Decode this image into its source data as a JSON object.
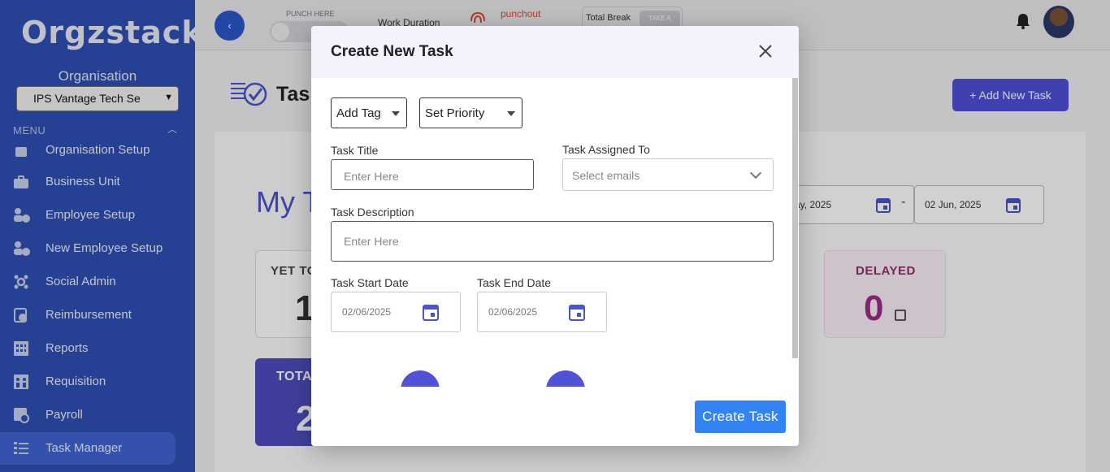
{
  "app": {
    "logo": "Orgzstack"
  },
  "sidebar": {
    "org_label": "Organisation",
    "org_value": "IPS Vantage Tech Se",
    "menu_label": "MENU",
    "items": [
      {
        "label": "Organisation Setup",
        "icon": "org-setup-icon"
      },
      {
        "label": "Business Unit",
        "icon": "briefcase-icon"
      },
      {
        "label": "Employee Setup",
        "icon": "users-gear-icon"
      },
      {
        "label": "New Employee Setup",
        "icon": "users-gear-icon"
      },
      {
        "label": "Social Admin",
        "icon": "social-icon"
      },
      {
        "label": "Reimbursement",
        "icon": "reimbursement-icon"
      },
      {
        "label": "Reports",
        "icon": "reports-icon"
      },
      {
        "label": "Requisition",
        "icon": "requisition-icon"
      },
      {
        "label": "Payroll",
        "icon": "payroll-icon"
      },
      {
        "label": "Task Manager",
        "icon": "task-list-icon",
        "active": true
      }
    ]
  },
  "topbar": {
    "punch_label": "PUNCH HERE",
    "work_duration": "Work Duration",
    "punchout": "punchout",
    "total_break": "Total Break",
    "take_break": "TAKE A"
  },
  "main": {
    "heading": "Task",
    "add_task": "+ Add New Task",
    "my_title": "My T",
    "date_from": "ay, 2025",
    "date_to": "02 Jun, 2025",
    "date_sep": "-",
    "yet_to_title": "YET TO",
    "yet_to_value": "1",
    "delayed_title": "DELAYED",
    "delayed_value": "0",
    "total_title": "TOTA",
    "total_value": "2"
  },
  "modal": {
    "title": "Create New Task",
    "add_tag": "Add Tag",
    "set_priority": "Set Priority",
    "task_title_label": "Task Title",
    "task_title_placeholder": "Enter Here",
    "assigned_label": "Task Assigned To",
    "assigned_placeholder": "Select emails",
    "description_label": "Task Description",
    "description_placeholder": "Enter Here",
    "start_label": "Task Start Date",
    "start_value": "02/06/2025",
    "end_label": "Task End Date",
    "end_value": "02/06/2025",
    "create_button": "Create Task"
  },
  "colors": {
    "sidebar": "#2f4fb5",
    "accent": "#5252d6",
    "create_button": "#3483f3"
  }
}
